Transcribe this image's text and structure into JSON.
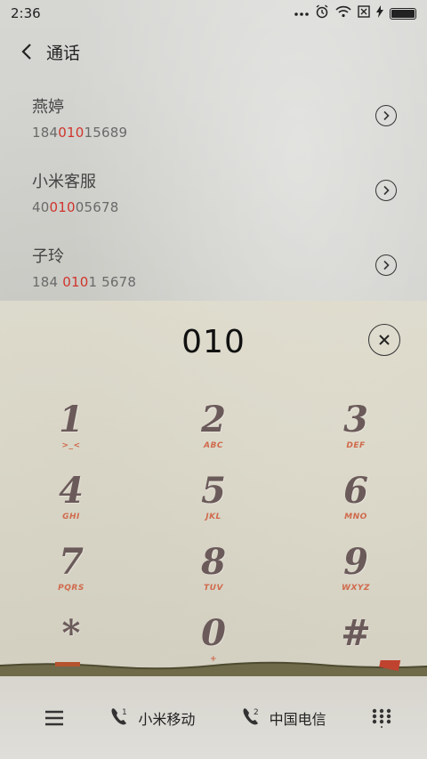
{
  "status_bar": {
    "time": "2:36",
    "icons": [
      "more-dots-icon",
      "alarm-icon",
      "wifi-icon",
      "no-sim-icon",
      "charging-icon",
      "battery-icon"
    ]
  },
  "header": {
    "title": "通话",
    "back_icon": "chevron-left-icon"
  },
  "contacts": [
    {
      "name": "燕婷",
      "number_before": "184",
      "number_match": "010",
      "number_after": "15689"
    },
    {
      "name": "小米客服",
      "number_before": "40",
      "number_match": "010",
      "number_after": "05678"
    },
    {
      "name": "子玲",
      "number_before": "184 ",
      "number_match": "010",
      "number_after": "1 5678"
    }
  ],
  "dialer": {
    "input_value": "010",
    "clear_icon": "close-circle-icon"
  },
  "keypad": [
    {
      "digit": "1",
      "letters": ">_<"
    },
    {
      "digit": "2",
      "letters": "ABC"
    },
    {
      "digit": "3",
      "letters": "DEF"
    },
    {
      "digit": "4",
      "letters": "GHI"
    },
    {
      "digit": "5",
      "letters": "JKL"
    },
    {
      "digit": "6",
      "letters": "MNO"
    },
    {
      "digit": "7",
      "letters": "PQRS"
    },
    {
      "digit": "8",
      "letters": "TUV"
    },
    {
      "digit": "9",
      "letters": "WXYZ"
    },
    {
      "digit": "*",
      "letters": ""
    },
    {
      "digit": "0",
      "letters": "+"
    },
    {
      "digit": "#",
      "letters": ""
    }
  ],
  "bottom_bar": {
    "sim1_label": "小米移动",
    "sim2_label": "中国电信",
    "sim1_badge": "1",
    "sim2_badge": "2"
  },
  "colors": {
    "highlight": "#d0342c",
    "key_digit": "#6b5a5a",
    "key_letters": "#d06a4c"
  }
}
